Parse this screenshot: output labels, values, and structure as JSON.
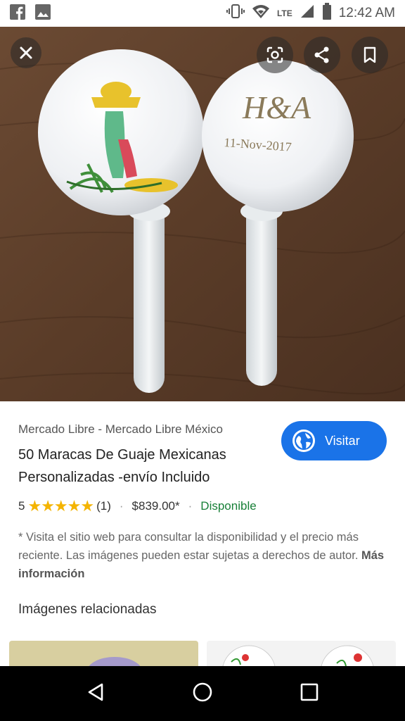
{
  "status_bar": {
    "time": "12:42 AM",
    "network": "LTE",
    "icons": [
      "facebook-icon",
      "image-icon",
      "vibrate-icon",
      "wifi-icon",
      "signal-icon",
      "battery-icon"
    ]
  },
  "image_viewer": {
    "close_icon": "close-icon",
    "lens_icon": "lens-icon",
    "share_icon": "share-icon",
    "save_icon": "bookmark-icon",
    "image_text": {
      "initials": "H&A",
      "date": "11-Nov-2017"
    }
  },
  "result": {
    "source": "Mercado Libre - Mercado Libre México",
    "title": "50 Maracas De Guaje Mexicanas Personalizadas -envío Incluido",
    "visit_label": "Visitar",
    "rating_value": "5",
    "stars": "★★★★★",
    "review_count": "(1)",
    "price": "$839.00*",
    "availability": "Disponible",
    "disclaimer": "* Visita el sitio web para consultar la disponibilidad y el precio más reciente. Las imágenes pueden estar sujetas a derechos de autor.",
    "more_info": "Más información"
  },
  "related": {
    "title": "Imágenes relacionadas"
  },
  "nav_bar": {
    "icons": [
      "back-icon",
      "home-icon",
      "recents-icon"
    ]
  }
}
